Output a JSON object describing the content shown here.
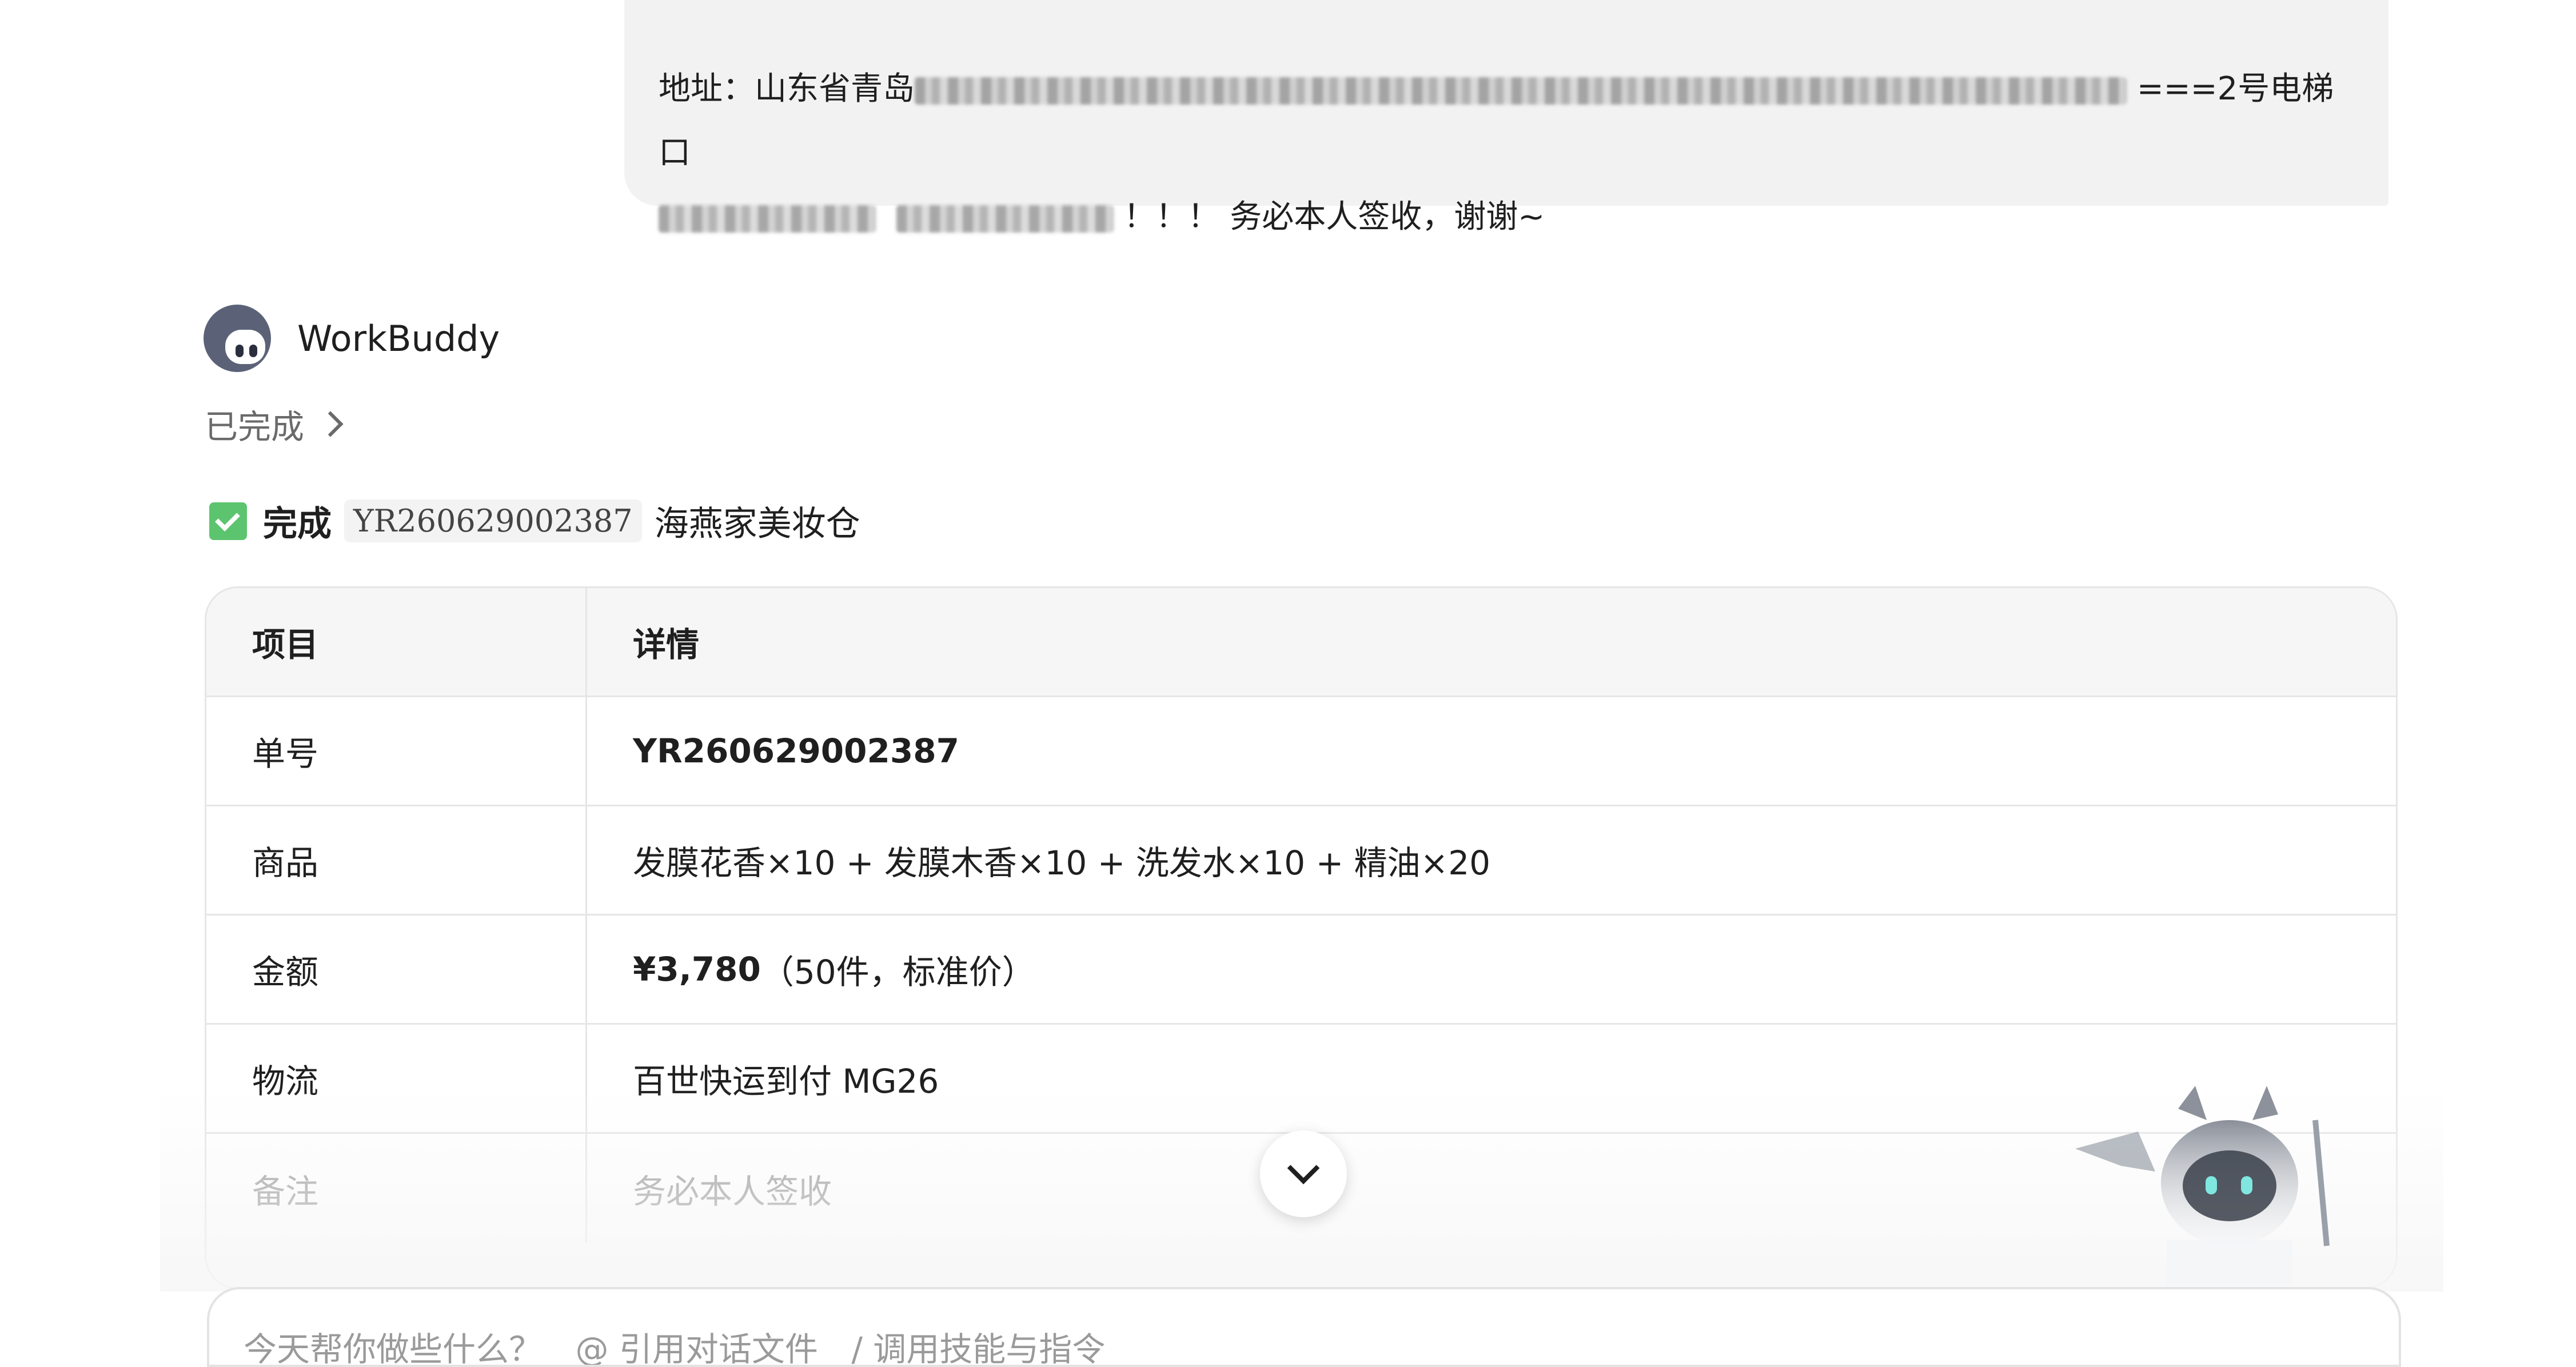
{
  "user_message": {
    "address_prefix": "地址：山东省青岛",
    "address_suffix": "===2号电梯口",
    "closing": "！！！ 务必本人签收，谢谢~"
  },
  "assistant": {
    "name": "WorkBuddy",
    "status": "已完成"
  },
  "result": {
    "done_label": "完成",
    "order_code": "YR260629002387",
    "warehouse": "海燕家美妆仓"
  },
  "table": {
    "header": {
      "key": "项目",
      "value": "详情"
    },
    "rows": [
      {
        "key": "单号",
        "value": "YR260629002387"
      },
      {
        "key": "商品",
        "value": "发膜花香×10 + 发膜木香×10 + 洗发水×10 + 精油×20"
      },
      {
        "key": "金额",
        "value_bold": "¥3,780",
        "value_rest": "（50件，标准价）"
      },
      {
        "key": "物流",
        "value": "百世快运到付 MG26"
      },
      {
        "key": "备注",
        "value": "务必本人签收"
      }
    ]
  },
  "composer": {
    "placeholder": "今天帮你做些什么？",
    "hint_at": "@ 引用对话文件",
    "hint_slash": "/ 调用技能与指令"
  }
}
